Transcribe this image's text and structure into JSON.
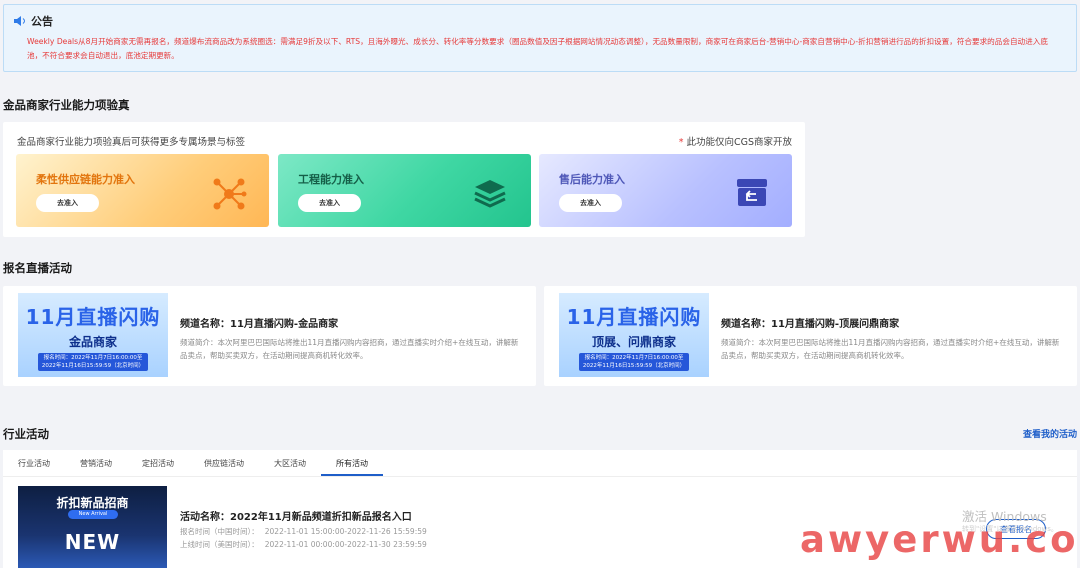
{
  "notice": {
    "title": "公告",
    "text": "Weekly Deals从8月开始商家无需再报名，频道爆布流商品改为系统圈选：需满足9折及以下、RTS，且海外曝光、成长分、转化率等分数要求（圈品数值及因子根据网站情况动态调整），无品数量限制，商家可在商家后台-营销中心-商家自营销中心-折扣营销进行品的折扣设置，符合要求的品会自动进入底池，不符合要求会自动退出，底池定期更新。"
  },
  "capability": {
    "section_title": "金品商家行业能力项验真",
    "desc": "金品商家行业能力项验真后可获得更多专属场景与标签",
    "note_star": "*",
    "note": "此功能仅向CGS商家开放",
    "cards": [
      {
        "title": "柔性供应链能力准入",
        "button": "去准入",
        "icon": "network-icon"
      },
      {
        "title": "工程能力准入",
        "button": "去准入",
        "icon": "layers-icon"
      },
      {
        "title": "售后能力准入",
        "button": "去准入",
        "icon": "return-box-icon"
      }
    ]
  },
  "live": {
    "section_title": "报名直播活动",
    "items": [
      {
        "banner_big": "11月直播闪购",
        "banner_sub": "金品商家",
        "banner_time": "报名时间：2022年11月7日16:00:00至 2022年11月16日15:59:59（北京时间）",
        "title": "频道名称：11月直播闪购-金品商家",
        "desc": "频道简介：本次阿里巴巴国际站将推出11月直播闪购内容招商，通过直播实时介绍+在线互动，讲解新品卖点，帮助买卖双方，在活动期间提高商机转化效率。"
      },
      {
        "banner_big": "11月直播闪购",
        "banner_sub": "顶展、问鼎商家",
        "banner_time": "报名时间：2022年11月7日16:00:00至 2022年11月16日15:59:59（北京时间）",
        "title": "频道名称：11月直播闪购-顶展问鼎商家",
        "desc": "频道简介：本次阿里巴巴国际站将推出11月直播闪购内容招商，通过直播实时介绍+在线互动，讲解新品卖点，帮助买卖双方，在活动期间提高商机转化效率。"
      }
    ]
  },
  "industry": {
    "section_title": "行业活动",
    "link": "查看我的活动",
    "tabs": [
      "行业活动",
      "营销活动",
      "定招活动",
      "供应链活动",
      "大区活动",
      "所有活动"
    ],
    "active_tab": "所有活动",
    "activity": {
      "img_title": "折扣新品招商",
      "img_pill": "New Arrival",
      "img_big": "NEW",
      "title": "活动名称：2022年11月新品频道折扣新品报名入口",
      "reg_label": "报名时间（中国时间）：",
      "reg_time": "2022-11-01 15:00:00-2022-11-26 15:59:59",
      "online_label": "上线时间（美国时间）：",
      "online_time": "2022-11-01 00:00:00-2022-11-30 23:59:59",
      "button": "查看报名"
    }
  },
  "windows_watermark": {
    "line1": "激活 Windows",
    "line2": "转到\"设置\"以激活 Windows。"
  },
  "site_watermark": "awyerwu.com",
  "colors": {
    "accent": "#1e5ec9",
    "warning_text": "#e63a3a",
    "notice_bg": "#eaf4fd"
  }
}
